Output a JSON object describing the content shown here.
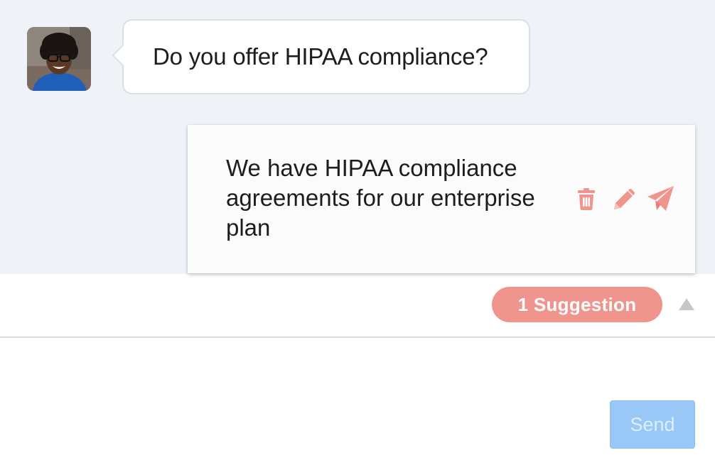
{
  "conversation": {
    "customer": {
      "avatar_icon": "customer-avatar-photo",
      "message": "Do you offer HIPAA compliance?"
    },
    "suggested_reply": {
      "text": "We have HIPAA compliance agreements for our enterprise plan",
      "actions": [
        {
          "icon": "trash-icon",
          "label": "Delete"
        },
        {
          "icon": "pencil-icon",
          "label": "Edit"
        },
        {
          "icon": "paper-plane-icon",
          "label": "Send suggestion"
        }
      ]
    }
  },
  "suggestions_bar": {
    "pill_label": "1 Suggestion",
    "toggle_icon": "triangle-up-icon"
  },
  "composer": {
    "send_label": "Send"
  },
  "colors": {
    "chat_background": "#eff3f7",
    "accent_coral": "#f0958d",
    "send_button_disabled": "#99c8f6"
  }
}
